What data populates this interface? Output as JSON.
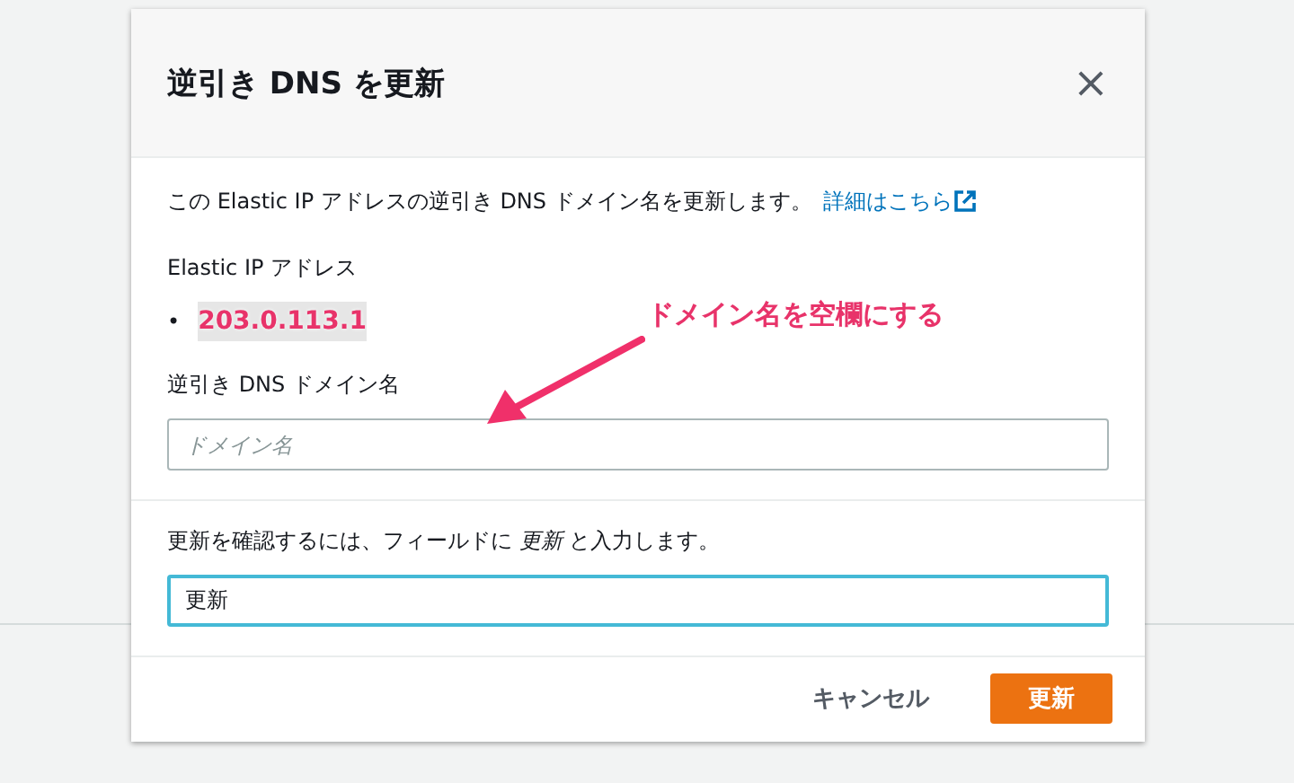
{
  "dialog": {
    "title": "逆引き DNS を更新",
    "close": "×"
  },
  "description": {
    "text": "この Elastic IP アドレスの逆引き DNS ドメイン名を更新します。",
    "link": "詳細はこちら"
  },
  "address": {
    "label": "Elastic IP アドレス",
    "items": [
      {
        "bullet": "•",
        "text": "203.0.113.1"
      }
    ]
  },
  "annotation": {
    "text": "ドメイン名を空欄にする"
  },
  "domain_field": {
    "label": "逆引き DNS ドメイン名",
    "placeholder": "ドメイン名"
  },
  "confirm_field": {
    "label": "更新を確認するには、フィールドに *更新* と入力します。",
    "value": "更新"
  },
  "buttons": [
    {
      "label": "キャンセル",
      "kind": "secondary"
    },
    {
      "label": "更新",
      "kind": "primary"
    }
  ]
}
